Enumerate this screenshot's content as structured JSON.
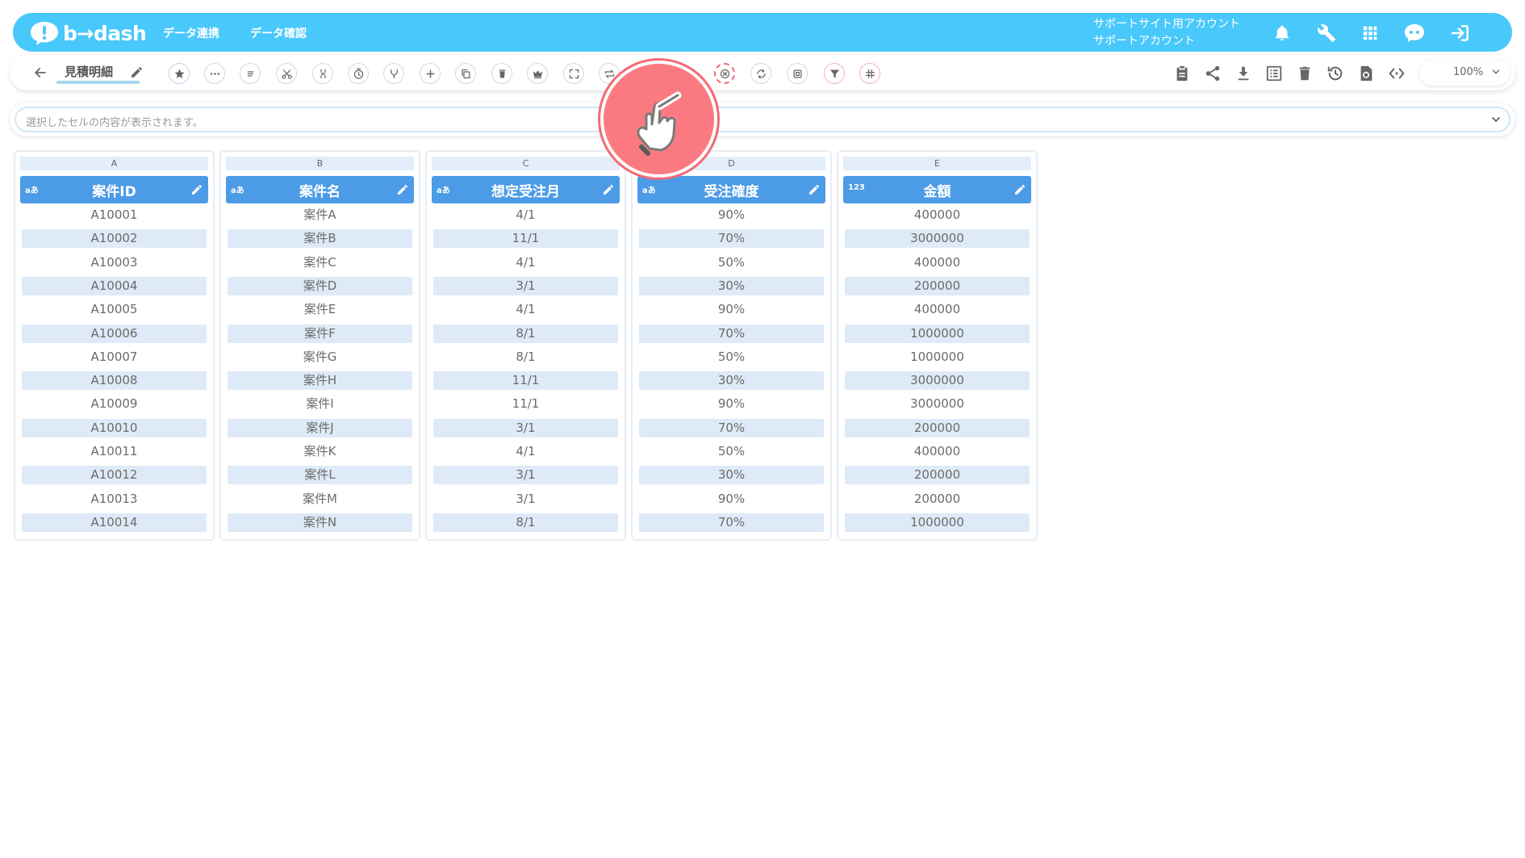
{
  "header": {
    "logo_text": "b→dash",
    "nav": [
      "データ連携",
      "データ確認"
    ],
    "account_line1": "サポートサイト用アカウント",
    "account_line2": "サポートアカウント"
  },
  "toolbar": {
    "sheet_name": "見積明細",
    "zoom": "100%"
  },
  "formula_bar": {
    "placeholder": "選択したセルの内容が表示されます。"
  },
  "columns": [
    {
      "letter": "A",
      "type": "aあ",
      "title": "案件ID",
      "cells": [
        "A10001",
        "A10002",
        "A10003",
        "A10004",
        "A10005",
        "A10006",
        "A10007",
        "A10008",
        "A10009",
        "A10010",
        "A10011",
        "A10012",
        "A10013",
        "A10014"
      ]
    },
    {
      "letter": "B",
      "type": "aあ",
      "title": "案件名",
      "cells": [
        "案件A",
        "案件B",
        "案件C",
        "案件D",
        "案件E",
        "案件F",
        "案件G",
        "案件H",
        "案件I",
        "案件J",
        "案件K",
        "案件L",
        "案件M",
        "案件N"
      ]
    },
    {
      "letter": "C",
      "type": "aあ",
      "title": "想定受注月",
      "cells": [
        "4/1",
        "11/1",
        "4/1",
        "3/1",
        "4/1",
        "8/1",
        "8/1",
        "11/1",
        "11/1",
        "3/1",
        "4/1",
        "3/1",
        "3/1",
        "8/1"
      ]
    },
    {
      "letter": "D",
      "type": "aあ",
      "title": "受注確度",
      "cells": [
        "90%",
        "70%",
        "50%",
        "30%",
        "90%",
        "70%",
        "50%",
        "30%",
        "90%",
        "70%",
        "50%",
        "30%",
        "90%",
        "70%"
      ]
    },
    {
      "letter": "E",
      "type": "123",
      "title": "金額",
      "cells": [
        "400000",
        "3000000",
        "400000",
        "200000",
        "400000",
        "1000000",
        "1000000",
        "3000000",
        "3000000",
        "200000",
        "400000",
        "200000",
        "200000",
        "1000000"
      ]
    }
  ],
  "colors": {
    "header_bg": "#49c8fb",
    "column_header_bg": "#4c9be7",
    "row_alt_bg": "#deeaf7",
    "highlight": "#ef6b73"
  }
}
